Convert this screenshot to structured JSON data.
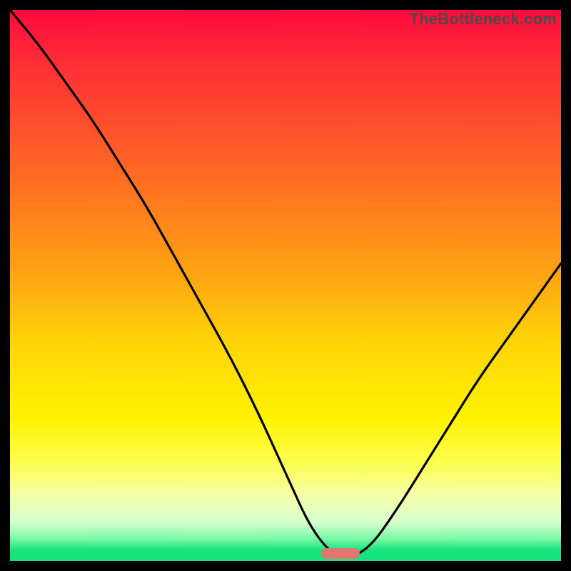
{
  "watermark": "TheBottleneck.com",
  "colors": {
    "frame": "#000000",
    "curve": "#000000",
    "marker": "#e1756f",
    "gradient_stops": [
      "#ff0a3d",
      "#ff2f36",
      "#ff6a24",
      "#ffa413",
      "#ffd309",
      "#fff200",
      "#fdff4e",
      "#f5ffa7",
      "#d6ffcf",
      "#79f9a4",
      "#18e37e"
    ]
  },
  "chart_data": {
    "type": "line",
    "title": "",
    "xlabel": "",
    "ylabel": "",
    "xlim": [
      0,
      100
    ],
    "ylim": [
      0,
      100
    ],
    "legend": false,
    "grid": false,
    "note": "V-shaped bottleneck curve; percent mismatch vs a swept parameter. Minimum (optimal point) near x≈60. Values approximated from pixel height against full plot height = 100%.",
    "series": [
      {
        "name": "bottleneck-percent",
        "x": [
          0,
          5,
          10,
          15,
          20,
          25,
          30,
          35,
          40,
          45,
          50,
          55,
          60,
          65,
          70,
          75,
          80,
          85,
          90,
          95,
          100
        ],
        "values": [
          100,
          94,
          87,
          80,
          72,
          64,
          55,
          46,
          37,
          27,
          16,
          5,
          0,
          2,
          9,
          17,
          25,
          33,
          40,
          47,
          54
        ]
      }
    ],
    "marker": {
      "x": 60,
      "y": 0,
      "width_percent": 7
    }
  }
}
